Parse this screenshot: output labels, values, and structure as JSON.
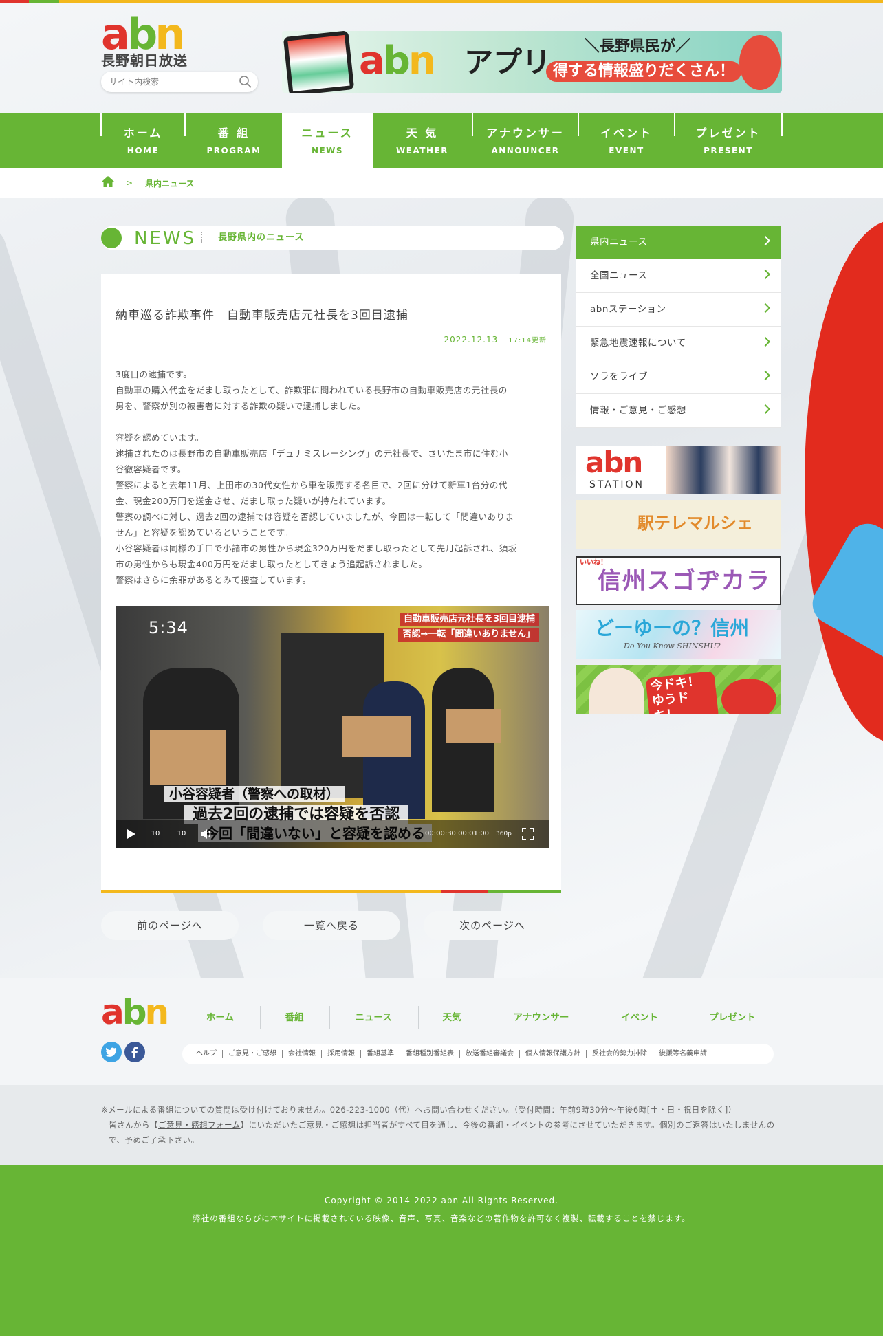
{
  "site": {
    "logo_text": "abn",
    "logo_sub": "長野朝日放送",
    "colors": {
      "brand_green": "#67b535",
      "brand_red": "#e0342d",
      "brand_yellow": "#f3b81d"
    }
  },
  "search": {
    "placeholder": "サイト内検索",
    "icon": "search-icon"
  },
  "app_banner": {
    "logo": "abn",
    "title": "アプリ",
    "tagline1": "＼長野県民が／",
    "tagline_badge": "得",
    "tagline2": "する情報盛りだくさん！"
  },
  "nav": {
    "items": [
      {
        "jp": "ホーム",
        "en": "HOME"
      },
      {
        "jp": "番 組",
        "en": "PROGRAM"
      },
      {
        "jp": "ニュース",
        "en": "NEWS"
      },
      {
        "jp": "天 気",
        "en": "WEATHER"
      },
      {
        "jp": "アナウンサー",
        "en": "ANNOUNCER"
      },
      {
        "jp": "イベント",
        "en": "EVENT"
      },
      {
        "jp": "プレゼント",
        "en": "PRESENT"
      }
    ],
    "active_index": 2
  },
  "breadcrumb": {
    "home_icon": "home-icon",
    "separator": ">",
    "current": "県内ニュース"
  },
  "news_header": {
    "en": "NEWS",
    "jp": "長野県内のニュース"
  },
  "article": {
    "title": "納車巡る詐欺事件　自動車販売店元社長を3回目逮捕",
    "date": "2022.12.13 - ",
    "updated": "17:14更新",
    "paragraphs": [
      "3度目の逮捕です。",
      "自動車の購入代金をだまし取ったとして、詐欺罪に問われている長野市の自動車販売店の元社長の",
      "男を、警察が別の被害者に対する詐欺の疑いで逮捕しました。",
      "",
      "容疑を認めています。",
      "逮捕されたのは長野市の自動車販売店「デュナミスレーシング」の元社長で、さいたま市に住む小",
      "谷徹容疑者です。",
      "警察によると去年11月、上田市の30代女性から車を販売する名目で、2回に分けて新車1台分の代",
      "金、現金200万円を送金させ、だまし取った疑いが持たれています。",
      "警察の調べに対し、過去2回の逮捕では容疑を否認していましたが、今回は一転して「間違いありま",
      "せん」と容疑を認めているということです。",
      "小谷容疑者は同様の手口で小諸市の男性から現金320万円をだまし取ったとして先月起訴され、須坂",
      "市の男性からも現金400万円をだまし取ったとしてきょう追起訴されました。",
      "警察はさらに余罪があるとみて捜査しています。"
    ]
  },
  "video": {
    "clock": "5:34",
    "caption_line1": "自動車販売店元社長を3回目逮捕",
    "caption_line2": "否認→一転「間違いありません」",
    "subtitle1": "小谷容疑者（警察への取材）",
    "subtitle2": "過去2回の逮捕では容疑を否認",
    "subtitle3": "今回「間違いない」と容疑を認める",
    "time_display": "00:00:30 00:01:00",
    "quality": "360p",
    "rewind_label": "10",
    "forward_label": "10"
  },
  "pager": {
    "prev": "前のページへ",
    "list": "一覧へ戻る",
    "next": "次のページへ"
  },
  "sidebar": {
    "items": [
      {
        "label": "県内ニュース"
      },
      {
        "label": "全国ニュース"
      },
      {
        "label": "abnステーション"
      },
      {
        "label": "緊急地震速報について"
      },
      {
        "label": "ソラをライブ"
      },
      {
        "label": "情報・ご意見・ご感想"
      }
    ],
    "active_index": 0
  },
  "banners": [
    {
      "logo": "abn",
      "label": "STATION"
    },
    {
      "label": "駅テレマルシェ"
    },
    {
      "label": "信州スゴヂカラ",
      "prefix": "いいね！"
    },
    {
      "label": "どーゆーの？信州",
      "sub": "Do You Know SHINSHU?"
    },
    {
      "label": "今ドキ！ゆうドキ！"
    }
  ],
  "footer": {
    "logo": "abn",
    "nav": [
      "ホーム",
      "番組",
      "ニュース",
      "天気",
      "アナウンサー",
      "イベント",
      "プレゼント"
    ],
    "links": [
      "ヘルプ",
      "ご意見・ご感想",
      "会社情報",
      "採用情報",
      "番組基準",
      "番組種別番組表",
      "放送番組審議会",
      "個人情報保護方針",
      "反社会的勢力排除",
      "後援等名義申請"
    ],
    "note1": "※メールによる番組についての質問は受け付けておりません。026-223-1000（代）へお問い合わせください。（受付時間：午前9時30分〜午後6時[土・日・祝日を除く]）",
    "note2_pre": "皆さんから【",
    "note2_link": "ご意見・感想フォーム",
    "note2_post": "】にいただいたご意見・ご感想は担当者がすべて目を通し、今後の番組・イベントの参考にさせていただきます。個別のご返答はいたしませんの",
    "note3": "で、予めご了承下さい。",
    "copyright": "Copyright © 2014-2022 abn All Rights Reserved.",
    "notice": "弊社の番組ならびに本サイトに掲載されている映像、音声、写真、音楽などの著作物を許可なく複製、転載することを禁じます。"
  }
}
